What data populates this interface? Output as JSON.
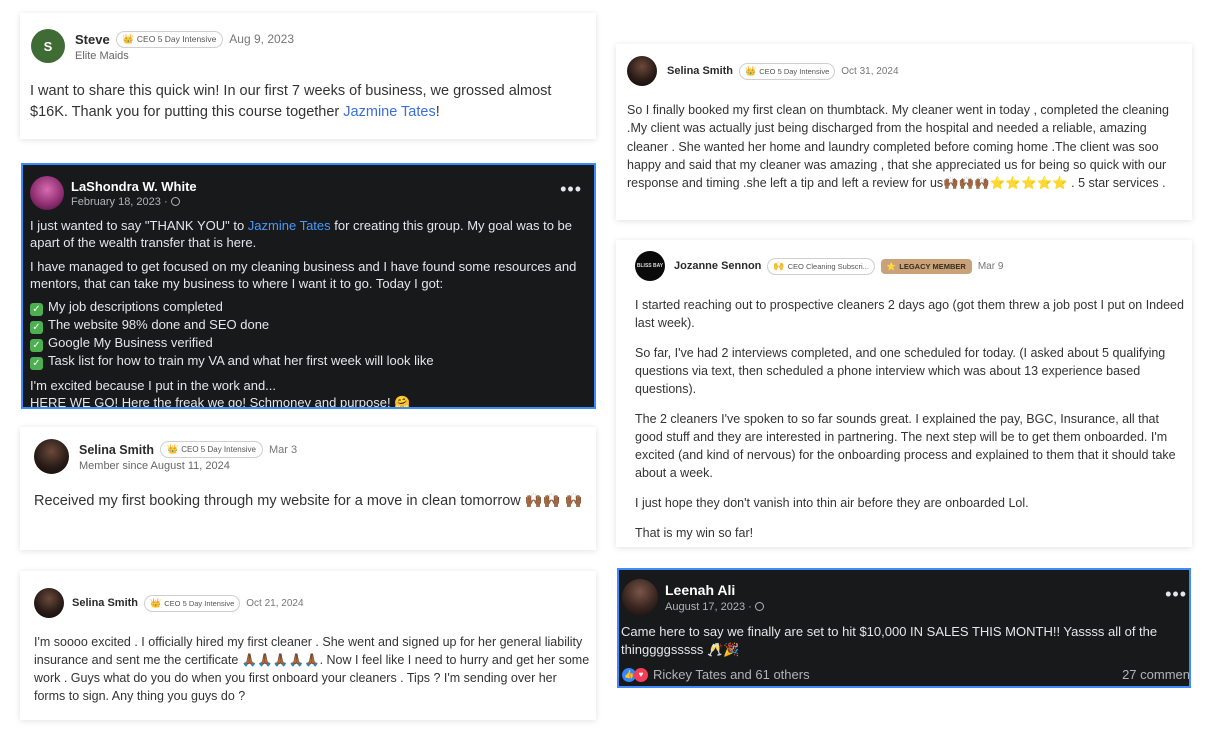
{
  "badges": {
    "ceo5": "CEO 5 Day Intensive",
    "ceo_sub": "CEO Cleaning Subscri...",
    "legacy": "LEGACY MEMBER"
  },
  "posts": {
    "steve": {
      "avatar_initial": "S",
      "name": "Steve",
      "company": "Elite Maids",
      "date": "Aug 9, 2023",
      "text_before": "I want to share this quick win! In our first 7 weeks of business, we grossed almost $16K. Thank you for putting this course together ",
      "link": "Jazmine Tates",
      "text_after": "!"
    },
    "lashondra": {
      "name": "LaShondra W. White",
      "date": "February 18, 2023 ·",
      "p1_before": "I just wanted to say \"THANK YOU\" to ",
      "p1_link": "Jazmine Tates",
      "p1_after": " for creating this group. My goal was to be apart of the wealth transfer that is here.",
      "p2": "I have managed to get focused on my cleaning business and I have found some resources and mentors, that can take my business to where I want it to go. Today I got:",
      "checks": [
        "My job descriptions completed",
        "The website 98% done and SEO done",
        "Google My Business verified",
        "Task list for how to train my VA and what her first week will look like"
      ],
      "p3": "I'm excited because I put in the work and...",
      "p4": "HERE WE GO! Here the freak we go! Schmoney and purpose! 🤗"
    },
    "selina_mar": {
      "name": "Selina Smith",
      "member_since": "Member since August 11, 2024",
      "date": "Mar 3",
      "text": "Received my first booking through my website for a move in clean tomorrow 🙌🏾🙌🏾 🙌🏾"
    },
    "selina_oct21": {
      "name": "Selina Smith",
      "date": "Oct 21, 2024",
      "text": "I'm soooo excited . I officially hired my first cleaner . She went and signed up for her general liability insurance and sent me the certificate 🙏🏾🙏🏾🙏🏾🙏🏾🙏🏾. Now I feel like I need to hurry and get her some work . Guys what do you do when you first onboard your cleaners . Tips ? I'm sending over her forms to sign. Any thing you guys do ?"
    },
    "selina_oct31": {
      "name": "Selina Smith",
      "date": "Oct 31, 2024",
      "text": "So I finally booked my first clean on thumbtack. My cleaner went in today , completed the cleaning .My client was actually just being discharged from the hospital and needed a reliable, amazing cleaner . She wanted her home and laundry completed before coming home .The client was soo happy and said that my cleaner was amazing , that she appreciated us for being so quick with our response and timing .she left a tip and left a review for us🙌🏾🙌🏾🙌🏾⭐⭐⭐⭐⭐ . 5 star services ."
    },
    "jozanne": {
      "avatar_text": "BLISS BAY",
      "name": "Jozanne Sennon",
      "date": "Mar 9",
      "paragraphs": [
        "I started reaching out to prospective cleaners 2 days ago (got them threw a job post I put on Indeed last week).",
        "So far, I've had 2 interviews completed, and one scheduled for today. (I asked about 5 qualifying questions via text, then scheduled a phone interview which was about 13 experience based questions).",
        "The 2 cleaners I've spoken to so far sounds great. I explained the pay, BGC, Insurance, all that good stuff and they are interested in partnering. The next step will be to get them onboarded. I'm excited (and kind of nervous) for the onboarding process and explained to them that it should take about a week.",
        "I just hope they don't vanish into thin air before they are onboarded Lol.",
        "That is my win so far!"
      ]
    },
    "leenah": {
      "name": "Leenah Ali",
      "date": "August 17, 2023 ·",
      "text": "Came here to say we finally are set to hit $10,000 IN SALES THIS MONTH!! Yassss all of the thinggggsssss 🥂🎉",
      "reactions": "Rickey Tates and 61 others",
      "comments": "27 commen"
    }
  },
  "colors": {
    "accent_blue": "#3d8bfd",
    "dark_bg": "#18191a",
    "link": "#3b6fd8"
  }
}
